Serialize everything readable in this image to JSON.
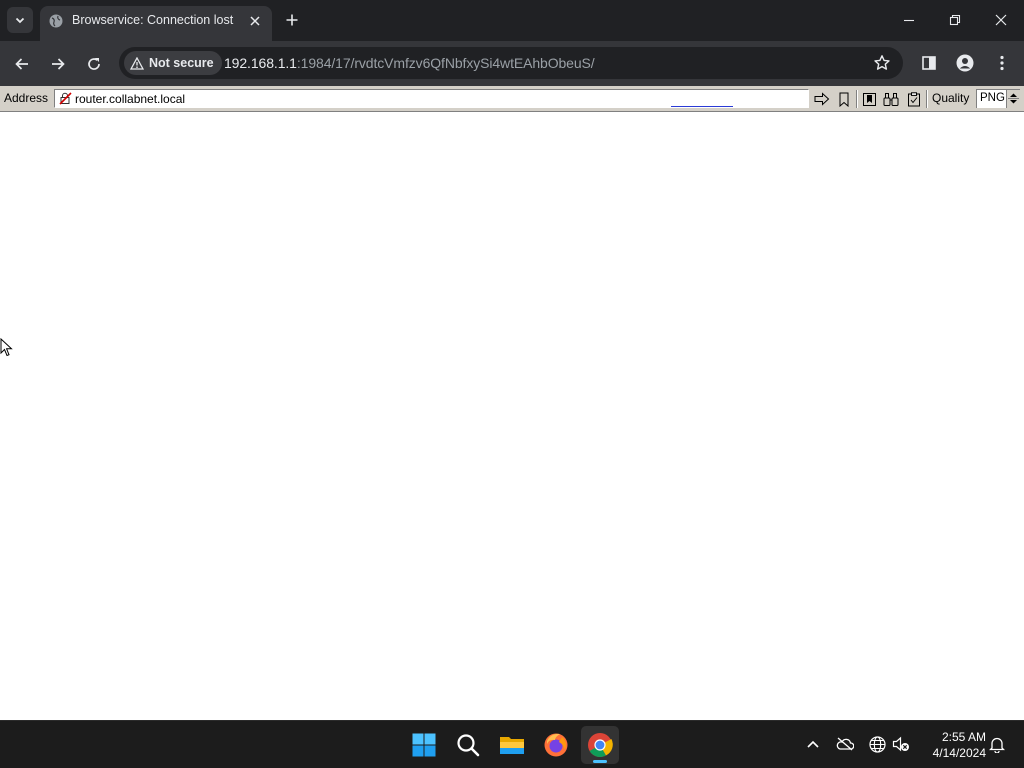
{
  "tab": {
    "title": "Browservice: Connection lost"
  },
  "toolbar": {
    "security_label": "Not secure",
    "url_host": "192.168.1.1",
    "url_rest": ":1984/17/rvdtcVmfzv6QfNbfxySi4wtEAhbObeuS/"
  },
  "browservice": {
    "address_label": "Address",
    "address_value": "router.collabnet.local",
    "quality_label": "Quality",
    "quality_value": "PNG"
  },
  "taskbar": {
    "apps": [
      "start-icon",
      "search-icon",
      "file-explorer-icon",
      "firefox-icon",
      "chrome-icon"
    ],
    "time": "2:55 AM",
    "date": "4/14/2024"
  },
  "colors": {
    "chrome_dark": "#202124",
    "chrome_toolbar": "#35363a",
    "browservice_bar": "#d4d0c8",
    "taskbar": "#1c1c1c",
    "accent": "#4cc2ff"
  }
}
